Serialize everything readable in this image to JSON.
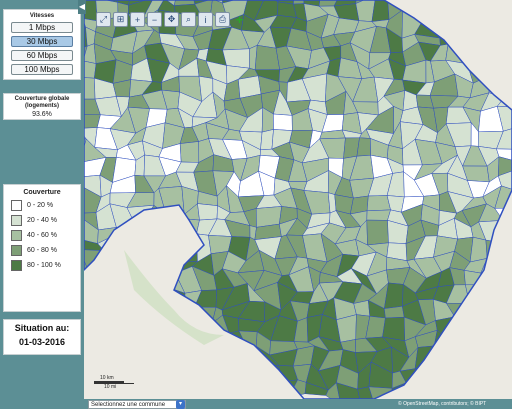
{
  "sidebar": {
    "speed": {
      "title": "Vitesses",
      "options": [
        "1 Mbps",
        "30 Mbps",
        "60 Mbps",
        "100 Mbps"
      ],
      "selected": "30 Mbps"
    },
    "coverage": {
      "title": "Couverture globale (logements)",
      "value": "93.6%"
    },
    "legend": {
      "title": "Couverture",
      "items": [
        {
          "label": "0 - 20 %",
          "color": "#ffffff"
        },
        {
          "label": "20 - 40 %",
          "color": "#d5e2d2"
        },
        {
          "label": "40 - 60 %",
          "color": "#a7c0a1"
        },
        {
          "label": "60 - 80 %",
          "color": "#7e9f76"
        },
        {
          "label": "80 - 100 %",
          "color": "#4d7a45"
        }
      ]
    },
    "situation": {
      "title": "Situation au:",
      "date": "01-03-2016"
    },
    "collapse_icon": "chevron-left-icon"
  },
  "toolbar": {
    "tools": [
      {
        "name": "zoom-extent-icon",
        "glyph": "⤢"
      },
      {
        "name": "zoom-box-icon",
        "glyph": "⊞"
      },
      {
        "name": "zoom-in-icon",
        "glyph": "+"
      },
      {
        "name": "zoom-out-icon",
        "glyph": "−"
      },
      {
        "name": "pan-icon",
        "glyph": "✥"
      },
      {
        "name": "search-icon",
        "glyph": "⌕"
      },
      {
        "name": "info-icon",
        "glyph": "i"
      },
      {
        "name": "print-icon",
        "glyph": "⎙"
      },
      {
        "name": "add-icon",
        "glyph": "+"
      }
    ]
  },
  "map": {
    "scale_km": "10 km",
    "scale_mi": "10 mi",
    "boundary_color": "#2f4fc0"
  },
  "footer": {
    "commune_select": "Selectionnez une commune",
    "attribution": "© OpenStreetMap, contributors; © BIPT"
  }
}
